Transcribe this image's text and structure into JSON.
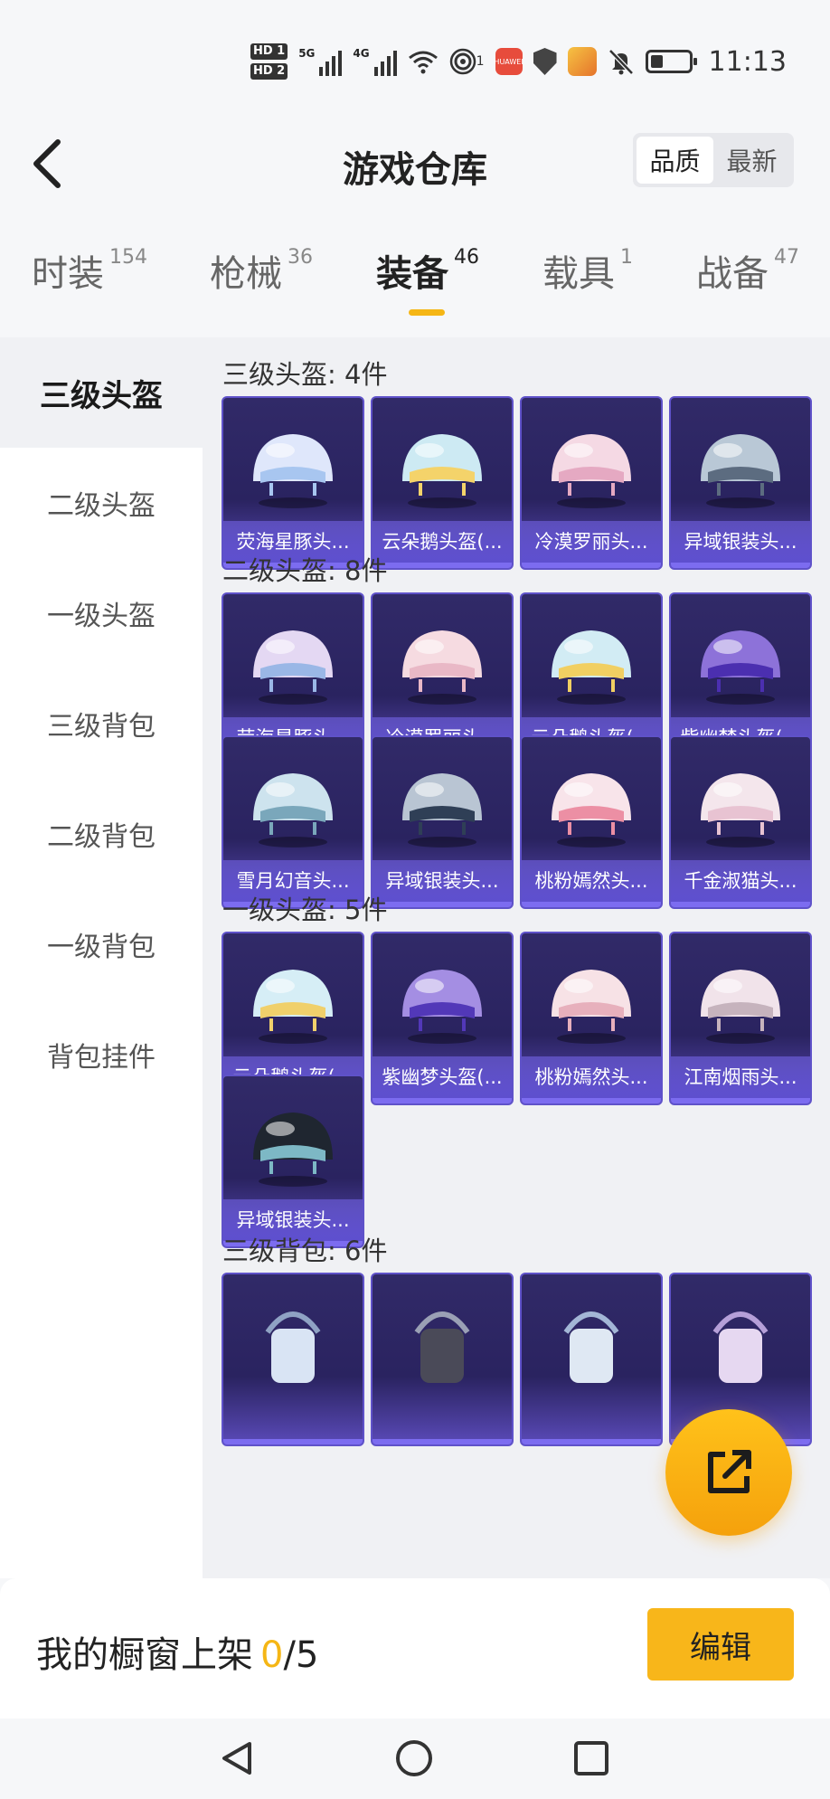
{
  "status_bar": {
    "time": "11:13",
    "hd1": "HD 1",
    "hd2": "HD 2",
    "signal1_label": "5G",
    "signal2_label": "4G",
    "hotspot_count": "1",
    "huawei_label": "HUAWEI",
    "icons": [
      "hd-icon",
      "signal-5g-icon",
      "signal-4g-icon",
      "wifi-icon",
      "hotspot-icon",
      "huawei-app-icon",
      "shield-icon",
      "game-app-icon",
      "mute-icon",
      "battery-icon"
    ]
  },
  "header": {
    "title": "游戏仓库",
    "sort_options": [
      "品质",
      "最新"
    ],
    "sort_selected": "品质"
  },
  "category_tabs": [
    {
      "label": "时装",
      "count": "154"
    },
    {
      "label": "枪械",
      "count": "36"
    },
    {
      "label": "装备",
      "count": "46",
      "active": true
    },
    {
      "label": "载具",
      "count": "1"
    },
    {
      "label": "战备",
      "count": "47"
    }
  ],
  "sidebar": {
    "items": [
      "三级头盔",
      "二级头盔",
      "一级头盔",
      "三级背包",
      "二级背包",
      "一级背包",
      "背包挂件"
    ],
    "active": "三级头盔"
  },
  "sections": [
    {
      "title": "三级头盔: 4件",
      "items": [
        "荧海星豚头...",
        "云朵鹅头盔(...",
        "冷漠罗丽头...",
        "异域银装头..."
      ]
    },
    {
      "title": "二级头盔: 8件",
      "items": [
        "荧海星豚头...",
        "冷漠罗丽头...",
        "云朵鹅头盔(...",
        "紫幽梦头盔(...",
        "雪月幻音头...",
        "异域银装头...",
        "桃粉嫣然头...",
        "千金淑猫头..."
      ]
    },
    {
      "title": "一级头盔: 5件",
      "items": [
        "云朵鹅头盔(...",
        "紫幽梦头盔(...",
        "桃粉嫣然头...",
        "江南烟雨头...",
        "异域银装头..."
      ]
    },
    {
      "title": "三级背包: 6件",
      "items": [
        "",
        "",
        "",
        ""
      ]
    }
  ],
  "bottom": {
    "showcase_label": "我的橱窗上架",
    "showcase_current": "0",
    "showcase_separator": "/",
    "showcase_total": "5",
    "edit_label": "编辑"
  },
  "colors": {
    "accent": "#f5b615",
    "card_bg": "#2a2360",
    "card_label_bg": "#6a5ad8"
  }
}
